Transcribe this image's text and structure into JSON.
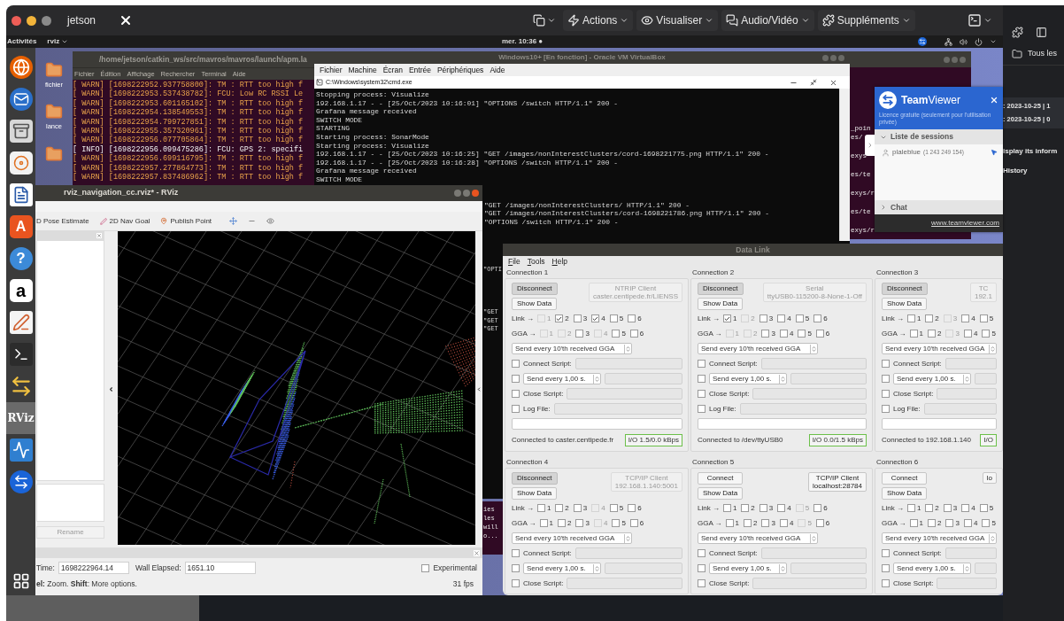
{
  "host_bar": {
    "title": "jetson",
    "menus": [
      {
        "label": "Actions",
        "kind": "bolt"
      },
      {
        "label": "Visualiser",
        "kind": "eye"
      },
      {
        "label": "Audio/Vidéo",
        "kind": "chat"
      },
      {
        "label": "Suppléments",
        "kind": "puzzle"
      }
    ]
  },
  "top_bar": {
    "activities": "Activités",
    "app": "rviz",
    "clock": "mer. 10:36 ●"
  },
  "dock": [
    {
      "kind": "browser",
      "selected": false
    },
    {
      "kind": "mail",
      "selected": false
    },
    {
      "kind": "files",
      "selected": false
    },
    {
      "kind": "music",
      "selected": false
    },
    {
      "kind": "document",
      "selected": false
    },
    {
      "kind": "glyph",
      "glyph": "A",
      "selected": false
    },
    {
      "kind": "help",
      "glyph": "?",
      "selected": false
    },
    {
      "kind": "shop",
      "glyph": "a",
      "selected": false
    },
    {
      "kind": "editor",
      "selected": false
    },
    {
      "kind": "terminal",
      "selected": false
    },
    {
      "kind": "transfer",
      "selected": false
    },
    {
      "kind": "rviz",
      "glyph": "RViz",
      "selected": true
    },
    {
      "kind": "monitor",
      "selected": false
    },
    {
      "kind": "remote",
      "selected": false
    }
  ],
  "desktop_icons": [
    {
      "label": "fichier"
    },
    {
      "label": "lance"
    }
  ],
  "terminal": {
    "title": "/home/jetson/catkin_ws/src/mavros/mavros/launch/apm.la",
    "menu": [
      "Fichier",
      "Édition",
      "Affichage",
      "Rechercher",
      "Terminal",
      "Aide"
    ],
    "lines": [
      {
        "kind": "warn",
        "text": "[ WARN] [1698222952.937758800]: TM : RTT too high f"
      },
      {
        "kind": "warn",
        "text": "[ WARN] [1698222953.537438782]: FCU: Low RC RSSI Le"
      },
      {
        "kind": "warn",
        "text": "[ WARN] [1698222953.601165102]: TM : RTT too high f"
      },
      {
        "kind": "warn",
        "text": "[ WARN] [1698222954.138549553]: TM : RTT too high f"
      },
      {
        "kind": "warn",
        "text": "[ WARN] [1698222954.799727851]: TM : RTT too high f"
      },
      {
        "kind": "warn",
        "text": "[ WARN] [1698222955.357320961]: TM : RTT too high f"
      },
      {
        "kind": "warn",
        "text": "[ WARN] [1698222956.077705864]: TM : RTT too high f"
      },
      {
        "kind": "info",
        "text": "[ INFO] [1698222956.099475286]: FCU: GPS 2: specifi"
      },
      {
        "kind": "warn",
        "text": "[ WARN] [1698222956.699116795]: TM : RTT too high f"
      },
      {
        "kind": "warn",
        "text": "[ WARN] [1698222957.277864773]: TM : RTT too high f"
      },
      {
        "kind": "warn",
        "text": "[ WARN] [1698222957.837486962]: TM : RTT too high f"
      }
    ]
  },
  "virtualbox": {
    "title": "Windows10+ [En fonction] - Oracle VM VirtualBox",
    "menu": [
      "Fichier",
      "Machine",
      "Écran",
      "Entrée",
      "Périphériques",
      "Aide"
    ],
    "cmd_title": "C:\\Windows\\system32\\cmd.exe",
    "lines": [
      "Stopping process: Visualize",
      "192.168.1.17 - - [25/Oct/2023 10:16:01] \"OPTIONS /switch HTTP/1.1\" 200 -",
      "Grafana message received",
      "SWITCH MODE",
      "STARTING",
      "Starting process: SonarMode",
      "Starting process: Visualize",
      "192.168.1.17 - - [25/Oct/2023 10:16:25] \"GET /images/nonInterestClusters/cord-1698221775.png HTTP/1.1\" 200 -",
      "192.168.1.17 - - [25/Oct/2023 10:16:28] \"OPTIONS /switch HTTP/1.1\" 200 -",
      "Grafana message received",
      "SWITCH MODE"
    ],
    "tail_lines": [
      "\"GET /images/nonInterestClusters/ HTTP/1.1\" 200 -",
      "\"GET /images/nonInterestClusters/cord-1698221786.png HTTP/1.1\" 200 -",
      "\"OPTIONS /switch HTTP/1.1\" 200 -"
    ],
    "edge_lines_upper": [
      "\"OPTI"
    ],
    "edge_lines_lower": [
      "\"GET",
      "\"GET",
      "\"GET"
    ]
  },
  "terminal_behind": {
    "fragments": [
      "_poin",
      "es/",
      "exys",
      "es/te",
      "exys/r",
      "es/te",
      "exys/r"
    ],
    "lower_fragments": [
      "ies",
      "les",
      "will",
      "o..."
    ]
  },
  "teamviewer": {
    "brand": "**Team**Viewer",
    "license": "Licence gratuite (seulement pour l'utilisation privée)",
    "sessions_header": "Liste de sessions",
    "sessions_expanded": true,
    "session": {
      "name": "plaleblue",
      "id": "(1 243 249 154)"
    },
    "chat_header": "Chat",
    "chat_expanded": false,
    "link": "www.teamviewer.com"
  },
  "browser_panel": {
    "folder": "Tous les",
    "dates": [
      ": 2023-10-25 | 1",
      ": 2023-10-25 | 0"
    ],
    "texts": [
      "isplay its inform",
      "History"
    ]
  },
  "rviz": {
    "title": "rviz_navigation_cc.rviz* - RViz",
    "tools": [
      {
        "label": "D Pose Estimate",
        "kind": "none"
      },
      {
        "label": "2D Nav Goal",
        "kind": "pen"
      },
      {
        "label": "Publish Point",
        "kind": "pin"
      }
    ],
    "rename": "Rename",
    "time_label": "Time:",
    "time_value": "1698222964.14",
    "elapsed_label": "Wall Elapsed:",
    "elapsed_value": "1651.10",
    "experimental": {
      "label": "Experimental",
      "checked": false
    },
    "hint": "**el:** Zoom. **Shift**: More options.",
    "fps": "31 fps"
  },
  "data_link": {
    "title": "Data Link",
    "menu": [
      "File",
      "Tools",
      "Help"
    ],
    "connections": [
      {
        "title": "Connection 1",
        "connected": true,
        "connect_button": "Disconnect",
        "show_data": "Show Data",
        "type_lines": [
          "NTRIP Client",
          "caster.centipede.fr/LIENSS"
        ],
        "link_label": "Link →",
        "link": [
          {
            "label": "1",
            "checked": false,
            "disabled": true
          },
          {
            "label": "2",
            "checked": true,
            "disabled": false
          },
          {
            "label": "3",
            "checked": false,
            "disabled": false
          },
          {
            "label": "4",
            "checked": true,
            "disabled": false
          },
          {
            "label": "5",
            "checked": false,
            "disabled": false
          },
          {
            "label": "6",
            "checked": false,
            "disabled": false
          }
        ],
        "gga_label": "GGA →",
        "gga": [
          {
            "label": "1",
            "checked": false,
            "disabled": true
          },
          {
            "label": "2",
            "checked": false,
            "disabled": true
          },
          {
            "label": "3",
            "checked": false,
            "disabled": false
          },
          {
            "label": "4",
            "checked": false,
            "disabled": true
          },
          {
            "label": "5",
            "checked": false,
            "disabled": false
          },
          {
            "label": "6",
            "checked": false,
            "disabled": false
          }
        ],
        "gga_mode": "Send every 10'th received GGA",
        "connect_script": {
          "label": "Connect Script:",
          "checked": false
        },
        "send_every": {
          "value": "Send every 1,00 s.",
          "checked": false
        },
        "close_script": {
          "label": "Close Script:",
          "checked": false
        },
        "log_file": {
          "label": "Log File:",
          "checked": false
        },
        "status": "Connected to caster.centipede.fr",
        "io": "I/O 1.5/0.0 kBps"
      },
      {
        "title": "Connection 2",
        "connected": true,
        "connect_button": "Disconnect",
        "show_data": "Show Data",
        "type_lines": [
          "Serial",
          "ttyUSB0-115200-8-None-1-Off"
        ],
        "link_label": "Link →",
        "link": [
          {
            "label": "1",
            "checked": true,
            "disabled": false
          },
          {
            "label": "2",
            "checked": false,
            "disabled": true
          },
          {
            "label": "3",
            "checked": false,
            "disabled": false
          },
          {
            "label": "4",
            "checked": false,
            "disabled": false
          },
          {
            "label": "5",
            "checked": false,
            "disabled": false
          },
          {
            "label": "6",
            "checked": false,
            "disabled": false
          }
        ],
        "gga_label": "GGA →",
        "gga": [
          {
            "label": "1",
            "checked": false,
            "disabled": true
          },
          {
            "label": "2",
            "checked": false,
            "disabled": true
          },
          {
            "label": "3",
            "checked": false,
            "disabled": false
          },
          {
            "label": "4",
            "checked": false,
            "disabled": false
          },
          {
            "label": "5",
            "checked": false,
            "disabled": false
          },
          {
            "label": "6",
            "checked": false,
            "disabled": false
          }
        ],
        "gga_mode": "Send every 10'th received GGA",
        "connect_script": {
          "label": "Connect Script:",
          "checked": false
        },
        "send_every": {
          "value": "Send every 1,00 s.",
          "checked": false
        },
        "close_script": {
          "label": "Close Script:",
          "checked": false
        },
        "log_file": {
          "label": "Log File:",
          "checked": false
        },
        "status": "Connected to /dev/ttyUSB0",
        "io": "I/O 0.0/1.5 kBps"
      },
      {
        "title": "Connection 3",
        "connected": true,
        "connect_button": "Disconnect",
        "show_data": "Show Data",
        "type_lines": [
          "TC",
          "192.1"
        ],
        "link_label": "Link →",
        "link": [
          {
            "label": "1",
            "checked": false,
            "disabled": false
          },
          {
            "label": "2",
            "checked": false,
            "disabled": false
          },
          {
            "label": "3",
            "checked": false,
            "disabled": true
          },
          {
            "label": "4",
            "checked": false,
            "disabled": false
          },
          {
            "label": "5",
            "checked": false,
            "disabled": false
          }
        ],
        "gga_label": "GGA →",
        "gga": [
          {
            "label": "1",
            "checked": false,
            "disabled": false
          },
          {
            "label": "2",
            "checked": false,
            "disabled": false
          },
          {
            "label": "3",
            "checked": false,
            "disabled": true
          },
          {
            "label": "4",
            "checked": false,
            "disabled": false
          },
          {
            "label": "5",
            "checked": false,
            "disabled": false
          }
        ],
        "gga_mode": "Send every 10'th received GGA",
        "connect_script": {
          "label": "Connect Script:",
          "checked": false
        },
        "send_every": {
          "value": "Send every 1,00 s.",
          "checked": false
        },
        "close_script": {
          "label": "Close Script:",
          "checked": false
        },
        "log_file": {
          "label": "Log File:",
          "checked": false
        },
        "status": "Connected to 192.168.1.140",
        "io": "I/O"
      },
      {
        "title": "Connection 4",
        "connected": true,
        "connect_button": "Disconnect",
        "show_data": "Show Data",
        "type_lines": [
          "TCP/IP Client",
          "192.168.1.140:5001"
        ],
        "link_label": "Link →",
        "link": [
          {
            "label": "1",
            "checked": false,
            "disabled": false
          },
          {
            "label": "2",
            "checked": false,
            "disabled": false
          },
          {
            "label": "3",
            "checked": false,
            "disabled": false
          },
          {
            "label": "4",
            "checked": false,
            "disabled": true
          },
          {
            "label": "5",
            "checked": false,
            "disabled": false
          },
          {
            "label": "6",
            "checked": false,
            "disabled": false
          }
        ],
        "gga_label": "GGA →",
        "gga": [
          {
            "label": "1",
            "checked": false,
            "disabled": false
          },
          {
            "label": "2",
            "checked": false,
            "disabled": false
          },
          {
            "label": "3",
            "checked": false,
            "disabled": false
          },
          {
            "label": "4",
            "checked": false,
            "disabled": true
          },
          {
            "label": "5",
            "checked": false,
            "disabled": false
          },
          {
            "label": "6",
            "checked": false,
            "disabled": false
          }
        ],
        "gga_mode": "Send every 10'th received GGA",
        "connect_script": {
          "label": "Connect Script:",
          "checked": false
        },
        "send_every": {
          "value": "Send every 1,00 s.",
          "checked": false
        },
        "close_script": {
          "label": "Close Script:",
          "checked": false
        }
      },
      {
        "title": "Connection 5",
        "connected": false,
        "connect_button": "Connect",
        "show_data": "Show Data",
        "type_lines": [
          "TCP/IP Client",
          "localhost:28784"
        ],
        "link_label": "Link →",
        "link": [
          {
            "label": "1",
            "checked": false,
            "disabled": false
          },
          {
            "label": "2",
            "checked": false,
            "disabled": false
          },
          {
            "label": "3",
            "checked": false,
            "disabled": false
          },
          {
            "label": "4",
            "checked": false,
            "disabled": false
          },
          {
            "label": "5",
            "checked": false,
            "disabled": true
          },
          {
            "label": "6",
            "checked": false,
            "disabled": false
          }
        ],
        "gga_label": "GGA →",
        "gga": [
          {
            "label": "1",
            "checked": false,
            "disabled": false
          },
          {
            "label": "2",
            "checked": false,
            "disabled": false
          },
          {
            "label": "3",
            "checked": false,
            "disabled": false
          },
          {
            "label": "4",
            "checked": false,
            "disabled": false
          },
          {
            "label": "5",
            "checked": false,
            "disabled": true
          },
          {
            "label": "6",
            "checked": false,
            "disabled": false
          }
        ],
        "gga_mode": "Send every 10'th received GGA",
        "connect_script": {
          "label": "Connect Script:",
          "checked": false
        },
        "send_every": {
          "value": "Send every 1,00 s.",
          "checked": false
        },
        "close_script": {
          "label": "Close Script:",
          "checked": false
        }
      },
      {
        "title": "Connection 6",
        "connected": false,
        "connect_button": "Connect",
        "show_data": "Show Data",
        "type_lines": [
          "lo"
        ],
        "link_label": "Link →",
        "link": [
          {
            "label": "1",
            "checked": false,
            "disabled": false
          },
          {
            "label": "2",
            "checked": false,
            "disabled": false
          },
          {
            "label": "3",
            "checked": false,
            "disabled": false
          },
          {
            "label": "4",
            "checked": false,
            "disabled": false
          },
          {
            "label": "5",
            "checked": false,
            "disabled": false
          }
        ],
        "gga_label": "GGA →",
        "gga": [
          {
            "label": "1",
            "checked": false,
            "disabled": false
          },
          {
            "label": "2",
            "checked": false,
            "disabled": false
          },
          {
            "label": "3",
            "checked": false,
            "disabled": false
          },
          {
            "label": "4",
            "checked": false,
            "disabled": false
          },
          {
            "label": "5",
            "checked": false,
            "disabled": false
          }
        ],
        "gga_mode": "Send every 10'th received GGA",
        "connect_script": {
          "label": "Connect Script:",
          "checked": false
        },
        "send_every": {
          "value": "Send every 1,00 s.",
          "checked": false
        },
        "close_script": {
          "label": "Close Script:",
          "checked": false
        }
      }
    ]
  }
}
